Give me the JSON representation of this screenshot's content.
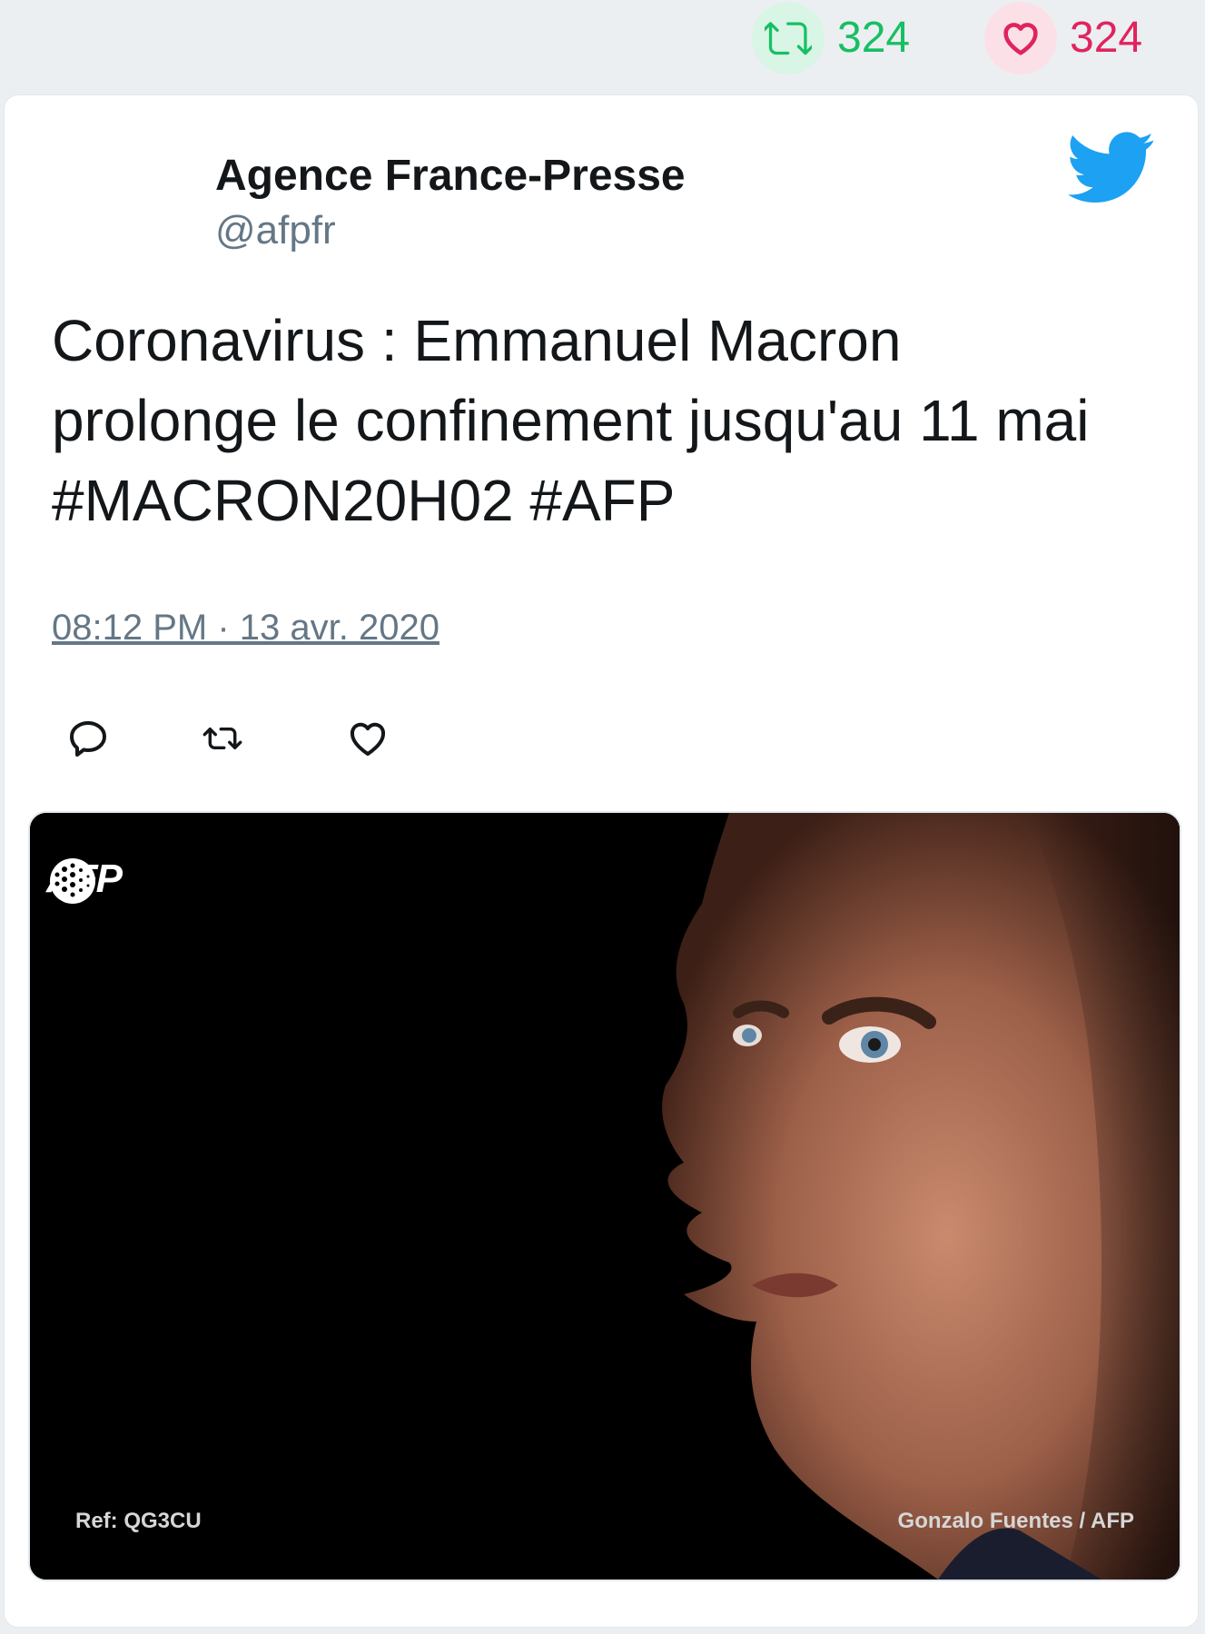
{
  "stats": {
    "retweets": "324",
    "likes": "324",
    "retweet_color": "#17bf63",
    "like_color": "#e0245e"
  },
  "tweet": {
    "author_name": "Agence France-Presse",
    "handle": "@afpfr",
    "text_lines": [
      "Coronavirus : Emmanuel Macron",
      "prolonge le confinement jusqu'au 11 mai",
      "#MACRON20H02 #AFP"
    ],
    "timestamp": "08:12 PM · 13 avr. 2020",
    "brand_icon": "twitter-bird-icon",
    "brand_color": "#1da1f2"
  },
  "actions": [
    {
      "icon": "reply-icon"
    },
    {
      "icon": "retweet-icon"
    },
    {
      "icon": "heart-icon"
    }
  ],
  "media": {
    "logo_text": "AFP",
    "ref": "Ref: QG3CU",
    "credit": "Gonzalo Fuentes / AFP"
  }
}
